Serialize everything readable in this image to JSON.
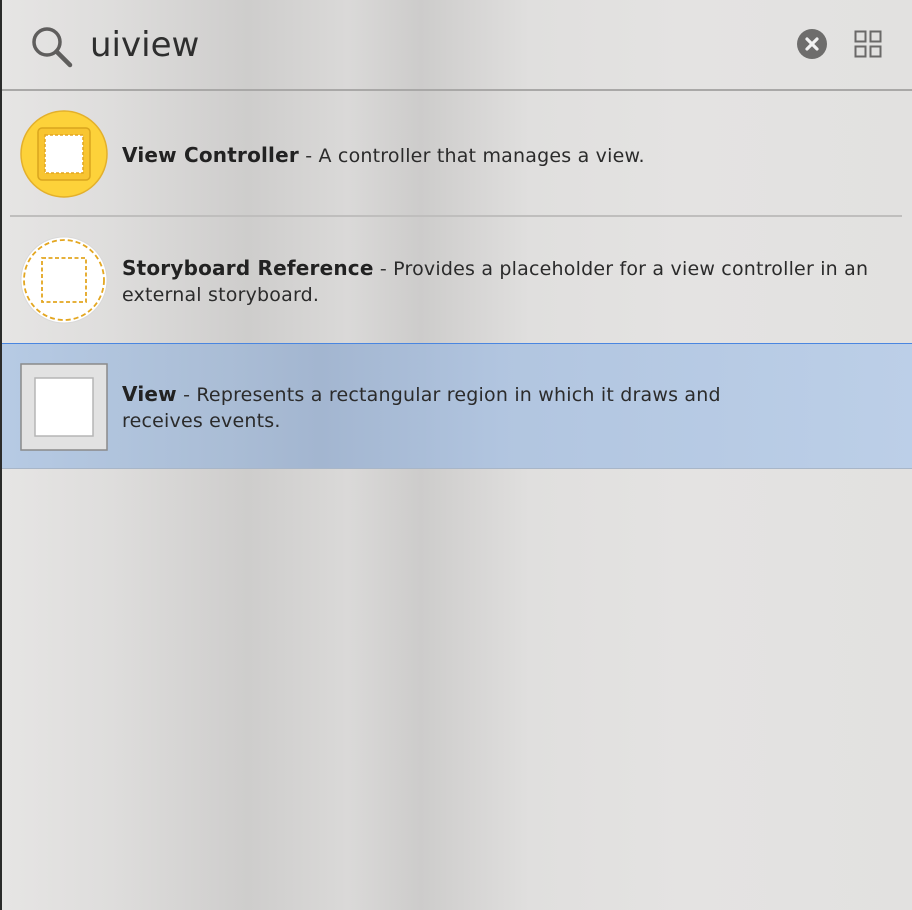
{
  "search": {
    "query": "uiview",
    "icon": "search-icon"
  },
  "toolbar": {
    "clear_icon": "close-circle-icon",
    "grid_icon": "grid-view-icon"
  },
  "results": [
    {
      "title": "View Controller",
      "separator": " - ",
      "description": "A controller that manages a view.",
      "icon": "view-controller-icon",
      "selected": false
    },
    {
      "title": "Storyboard Reference",
      "separator": " - ",
      "description": "Provides a placeholder for a view controller in an external storyboard.",
      "icon": "storyboard-reference-icon",
      "selected": false
    },
    {
      "title": "View",
      "separator": " - ",
      "description": "Represents a rectangular region in which it draws and receives events.",
      "icon": "view-icon",
      "selected": true
    }
  ],
  "colors": {
    "accent_yellow": "#fdd23a",
    "dash_orange": "#e3a620",
    "selection_blue": "#b2c8e4",
    "selection_border": "#4a86e0"
  }
}
